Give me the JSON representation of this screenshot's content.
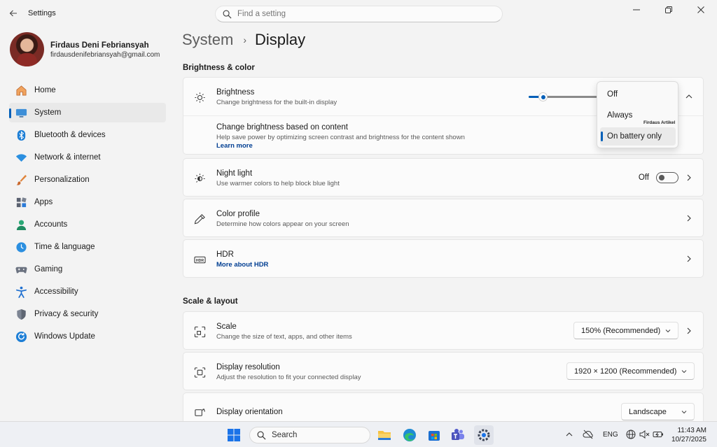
{
  "window": {
    "title": "Settings",
    "search_placeholder": "Find a setting"
  },
  "profile": {
    "name": "Firdaus Deni Febriansyah",
    "email": "firdausdenifebriansyah@gmail.com"
  },
  "sidebar": {
    "items": [
      {
        "label": "Home",
        "icon": "home-icon"
      },
      {
        "label": "System",
        "icon": "system-icon",
        "active": true
      },
      {
        "label": "Bluetooth & devices",
        "icon": "bluetooth-icon"
      },
      {
        "label": "Network & internet",
        "icon": "wifi-icon"
      },
      {
        "label": "Personalization",
        "icon": "brush-icon"
      },
      {
        "label": "Apps",
        "icon": "apps-icon"
      },
      {
        "label": "Accounts",
        "icon": "accounts-icon"
      },
      {
        "label": "Time & language",
        "icon": "globe-clock-icon"
      },
      {
        "label": "Gaming",
        "icon": "gamepad-icon"
      },
      {
        "label": "Accessibility",
        "icon": "accessibility-icon"
      },
      {
        "label": "Privacy & security",
        "icon": "shield-icon"
      },
      {
        "label": "Windows Update",
        "icon": "update-icon"
      }
    ]
  },
  "breadcrumb": {
    "parent": "System",
    "separator": "›",
    "current": "Display"
  },
  "brightness_section": {
    "title": "Brightness & color",
    "brightness": {
      "title": "Brightness",
      "subtitle": "Change brightness for the built-in display",
      "level": 0.2
    },
    "content_brightness": {
      "title": "Change brightness based on content",
      "subtitle": "Help save power by optimizing screen contrast and brightness for the content shown",
      "link": "Learn more"
    },
    "night_light": {
      "title": "Night light",
      "subtitle": "Use warmer colors to help block blue light",
      "state": "Off"
    },
    "color_profile": {
      "title": "Color profile",
      "subtitle": "Determine how colors appear on your screen"
    },
    "hdr": {
      "title": "HDR",
      "link": "More about HDR"
    }
  },
  "popup": {
    "options": [
      "Off",
      "Always",
      "On battery only"
    ],
    "selected": "On battery only",
    "watermark": "Firdaus Artikel"
  },
  "scale_section": {
    "title": "Scale & layout",
    "scale": {
      "title": "Scale",
      "subtitle": "Change the size of text, apps, and other items",
      "value": "150% (Recommended)"
    },
    "resolution": {
      "title": "Display resolution",
      "subtitle": "Adjust the resolution to fit your connected display",
      "value": "1920 × 1200 (Recommended)"
    },
    "orientation": {
      "title": "Display orientation",
      "value": "Landscape"
    }
  },
  "taskbar": {
    "search_label": "Search",
    "language": "ENG",
    "time": "11:43 AM",
    "date": "10/27/2025"
  },
  "colors": {
    "accent": "#005fb8",
    "link": "#003e92",
    "background": "#f3f3f3",
    "card": "#fbfbfb"
  }
}
